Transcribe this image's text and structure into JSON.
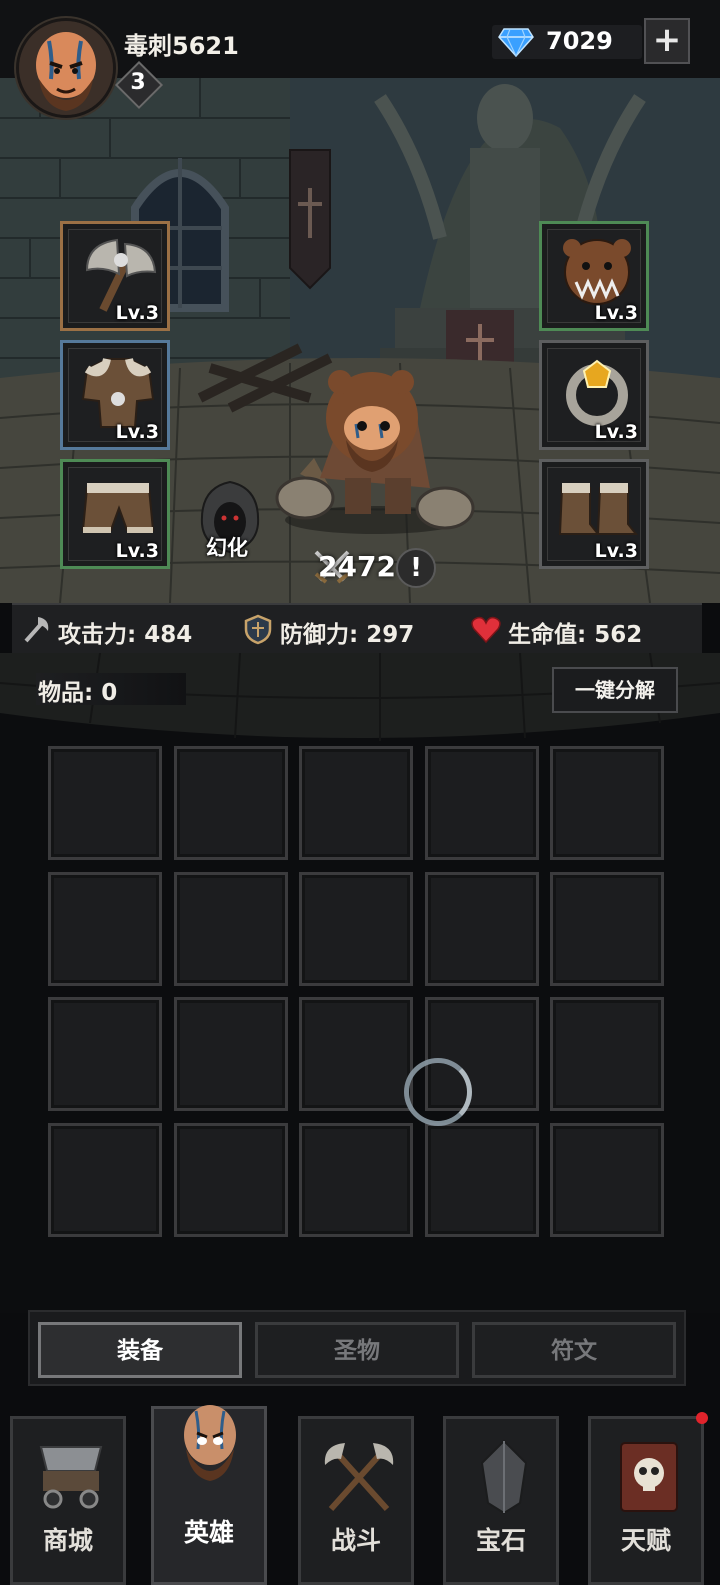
{
  "player": {
    "name": "毒刺5621",
    "level": "3",
    "gems": "7029",
    "gem_add_label": "+"
  },
  "equipment": {
    "left": [
      {
        "name": "axe",
        "level_label": "Lv.3",
        "rarity_color": "#9b7045"
      },
      {
        "name": "fur-armor",
        "level_label": "Lv.3",
        "rarity_color": "#56799a"
      },
      {
        "name": "fur-pants",
        "level_label": "Lv.3",
        "rarity_color": "#4e8a55"
      }
    ],
    "right": [
      {
        "name": "bear-helmet",
        "level_label": "Lv.3",
        "rarity_color": "#4e8a55"
      },
      {
        "name": "gem-ring",
        "level_label": "Lv.3",
        "rarity_color": "#5d5e5f"
      },
      {
        "name": "fur-boots",
        "level_label": "Lv.3",
        "rarity_color": "#5d5e5f"
      }
    ]
  },
  "hero": {
    "transform_label": "幻化",
    "combat_power": "2472",
    "info_label": "!"
  },
  "stats": {
    "attack": "攻击力: 484",
    "defense": "防御力: 297",
    "health": "生命值: 562"
  },
  "inventory": {
    "items_label": "物品: 0",
    "decompose_label": "一键分解",
    "rows": 4,
    "cols": 5
  },
  "tabs": [
    {
      "label": "装备",
      "active": true
    },
    {
      "label": "圣物",
      "active": false
    },
    {
      "label": "符文",
      "active": false
    }
  ],
  "nav": [
    {
      "label": "商城",
      "icon": "cart-icon",
      "active": false
    },
    {
      "label": "英雄",
      "icon": "hero-face-icon",
      "active": true
    },
    {
      "label": "战斗",
      "icon": "crossed-axes-icon",
      "active": false
    },
    {
      "label": "宝石",
      "icon": "crystal-icon",
      "active": false
    },
    {
      "label": "天赋",
      "icon": "skull-book-icon",
      "active": false
    }
  ],
  "colors": {
    "gem": "#3aa0ff",
    "heart": "#e0303a",
    "notification": "#e1232b"
  }
}
